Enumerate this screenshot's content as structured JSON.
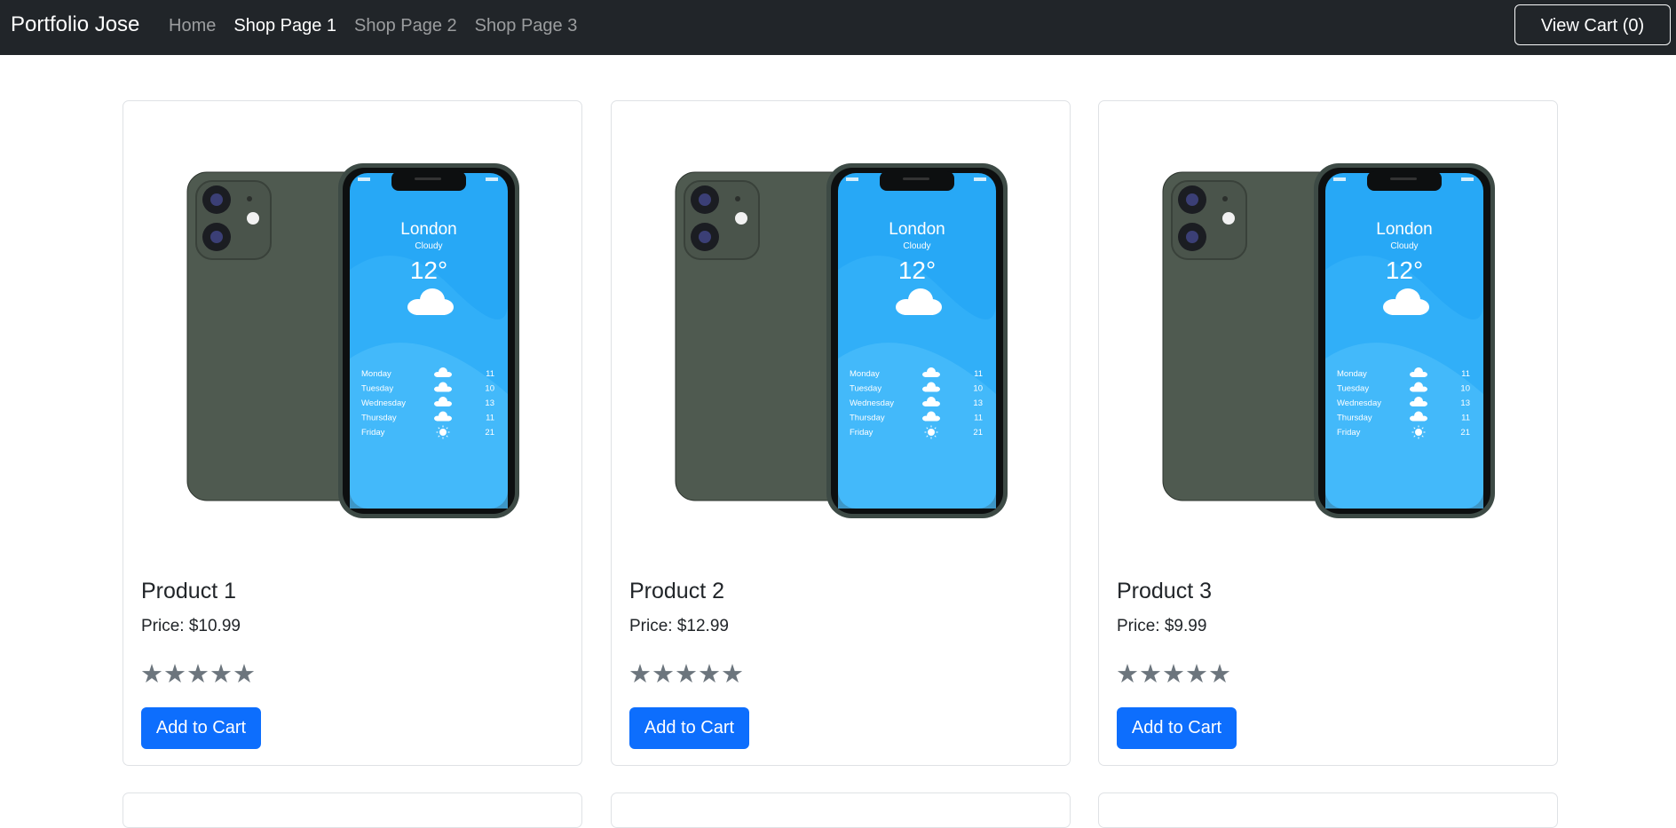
{
  "nav": {
    "brand": "Portfolio Jose",
    "links": [
      "Home",
      "Shop Page 1",
      "Shop Page 2",
      "Shop Page 3"
    ],
    "active_index": 1,
    "cart_label": "View Cart (0)"
  },
  "products": [
    {
      "title": "Product 1",
      "price": "Price: $10.99",
      "stars": "★★★★★",
      "button": "Add to Cart"
    },
    {
      "title": "Product 2",
      "price": "Price: $12.99",
      "stars": "★★★★★",
      "button": "Add to Cart"
    },
    {
      "title": "Product 3",
      "price": "Price: $9.99",
      "stars": "★★★★★",
      "button": "Add to Cart"
    }
  ],
  "phone_screen": {
    "city": "London",
    "condition": "Cloudy",
    "temp": "12°",
    "forecast": [
      {
        "day": "Monday",
        "temp": "11",
        "icon": "cloud-icon"
      },
      {
        "day": "Tuesday",
        "temp": "10",
        "icon": "cloud-icon"
      },
      {
        "day": "Wednesday",
        "temp": "13",
        "icon": "cloud-icon"
      },
      {
        "day": "Thursday",
        "temp": "11",
        "icon": "cloud-icon"
      },
      {
        "day": "Friday",
        "temp": "21",
        "icon": "sun-icon"
      }
    ]
  },
  "colors": {
    "navbar": "#212529",
    "primary": "#0d6efd",
    "star": "#6c757d",
    "phone_body": "#4f5a50",
    "screen_sky": "#27a8f6"
  }
}
